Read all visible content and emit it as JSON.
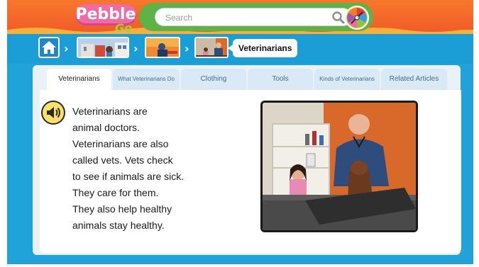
{
  "header": {
    "logo_text": "Pebble",
    "logo_sub": "Go",
    "search": {
      "placeholder": "Search",
      "value": ""
    }
  },
  "breadcrumb": {
    "current": "Veterinarians"
  },
  "tabs": [
    {
      "label": "Veterinarians",
      "active": true
    },
    {
      "label": "What Veterinarians Do",
      "active": false
    },
    {
      "label": "Clothing",
      "active": false
    },
    {
      "label": "Tools",
      "active": false
    },
    {
      "label": "Kinds of Veterinarians",
      "active": false
    },
    {
      "label": "Related Articles",
      "active": false
    }
  ],
  "article": {
    "lines": [
      "Veterinarians are",
      "animal doctors.",
      "Veterinarians are also",
      "called vets. Vets check",
      "to see if animals are sick.",
      "They care for them.",
      "They also help healthy",
      "animals stay healthy."
    ]
  },
  "colors": {
    "top_band": "#f05a28",
    "blue": "#1fa3d8",
    "search_pill": "#5fb246",
    "logo_pink": "#f06aa6",
    "audio_yellow": "#fbe06a"
  },
  "icons": [
    "home-icon",
    "speaker-icon",
    "search-icon",
    "spinner-wheel-icon",
    "chevron-right-icon"
  ]
}
